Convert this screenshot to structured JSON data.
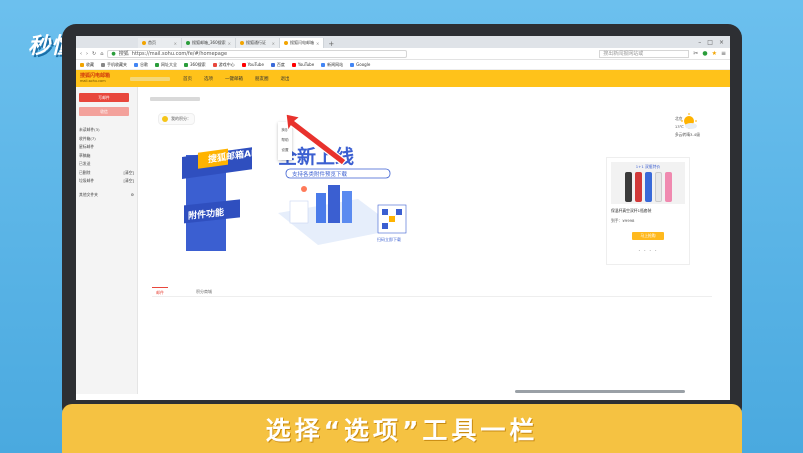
{
  "watermark": "秒懂视频",
  "caption": "选择“选项”工具一栏",
  "browser": {
    "tabs": [
      {
        "label": "首页"
      },
      {
        "label": "搜狐邮箱_360搜索"
      },
      {
        "label": "搜狐通行证"
      },
      {
        "label": "搜狐闪电邮箱"
      }
    ],
    "url": "https://mail.sohu.com/fe/#/homepage",
    "url_badge": "搜狐",
    "search_placeholder": "搜出新闻报网站或",
    "bookmarks": [
      "收藏",
      "手机收藏夹",
      "谷歌",
      "网址大全",
      "360搜索",
      "游戏中心",
      "YouTube",
      "百度",
      "YouTube",
      "新闻网站",
      "Google"
    ]
  },
  "mail": {
    "brand": "搜狐闪电邮箱",
    "brand_sub": "mail.sohu.com",
    "nav": [
      "首页",
      "选项",
      "一键邮箱",
      "朋友圈",
      "退出"
    ],
    "dropdown": [
      "换肤",
      "帮助",
      "设置"
    ],
    "sidebar": {
      "write": "写邮件",
      "receive": "收信",
      "folders": [
        {
          "label": "未读邮件(3)",
          "badge": ""
        },
        {
          "label": "收件箱(7)",
          "badge": ""
        },
        {
          "label": "星标邮件",
          "badge": ""
        },
        {
          "label": "草稿箱",
          "badge": ""
        },
        {
          "label": "已发送",
          "badge": ""
        },
        {
          "label": "已删除",
          "badge": "[清空]"
        },
        {
          "label": "垃圾邮件",
          "badge": "[清空]"
        }
      ],
      "other_folders": "其他文件夹"
    },
    "score_label": "我的积分：",
    "banner": {
      "headline": "全新上线",
      "subline": "支持各类附件预览下载",
      "app_label": "搜狐邮箱APP",
      "preview_label": "附件功能",
      "qr_caption": "扫码立即下载"
    },
    "weather": {
      "city": "北京",
      "temp": "13℃",
      "desc": "多云转晴3-4级"
    },
    "ad": {
      "tag": "1+1 双瓶特价",
      "title": "保温杯真空双杯1瓶套装",
      "price": "到手：¥9998",
      "buy": "马上抢购"
    },
    "bottom_tabs": [
      "邮件",
      "积分商城"
    ]
  },
  "colors": {
    "header_yellow": "#ffc21a",
    "accent_red": "#e8473c",
    "caption_bar": "#f5c242"
  }
}
